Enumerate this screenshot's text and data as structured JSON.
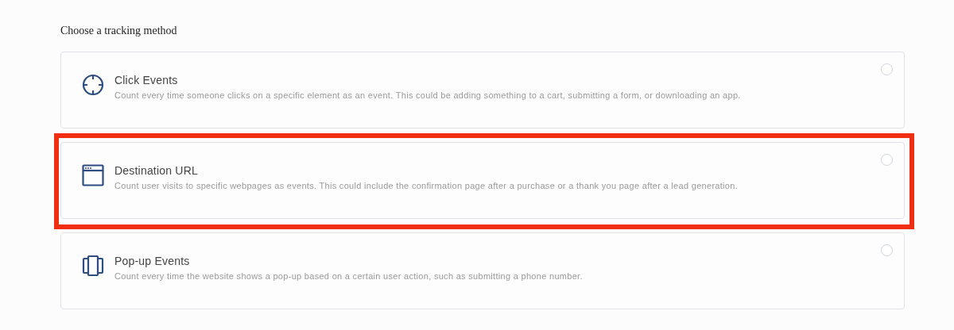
{
  "heading": "Choose a tracking method",
  "options": [
    {
      "kind": "click",
      "title": "Click Events",
      "description": "Count every time someone clicks on a specific element as an event. This could be adding something to a cart, submitting a form, or downloading an app.",
      "selected": false,
      "highlighted": false
    },
    {
      "kind": "destination",
      "title": "Destination URL",
      "description": "Count user visits to specific webpages as events. This could include the confirmation page after a purchase or a thank you page after a lead generation.",
      "selected": false,
      "highlighted": true
    },
    {
      "kind": "popup",
      "title": "Pop-up Events",
      "description": "Count every time the website shows a pop-up based on a certain user action, such as submitting a phone number.",
      "selected": false,
      "highlighted": false
    }
  ]
}
